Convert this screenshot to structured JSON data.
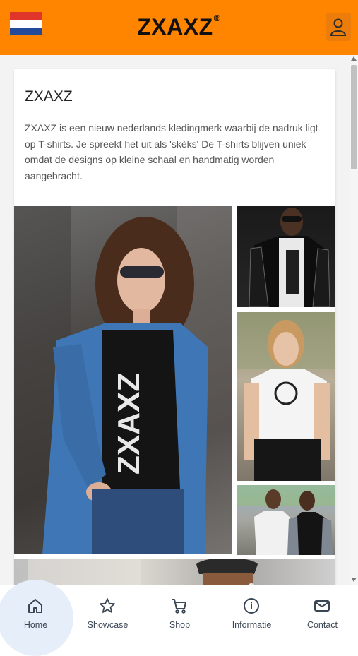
{
  "header": {
    "brand": "ZXAXZ",
    "registered_mark": "®",
    "flag": "netherlands-flag",
    "colors": {
      "background": "#ff8500",
      "button": "#ec7d0a"
    }
  },
  "intro": {
    "title": "ZXAXZ",
    "description": "ZXAXZ is een nieuw nederlands kledingmerk waarbij de nadruk ligt op T-shirts. Je spreekt het uit als 'skèks' De T-shirts blijven uniek omdat de designs op kleine schaal en handmatig worden aangebracht.",
    "shirt_print": "ZXAXZ"
  },
  "bottom_nav": {
    "items": [
      {
        "label": "Home",
        "icon": "home-icon",
        "active": true
      },
      {
        "label": "Showcase",
        "icon": "star-icon"
      },
      {
        "label": "Shop",
        "icon": "cart-icon"
      },
      {
        "label": "Informatie",
        "icon": "info-icon"
      },
      {
        "label": "Contact",
        "icon": "mail-icon"
      }
    ]
  }
}
